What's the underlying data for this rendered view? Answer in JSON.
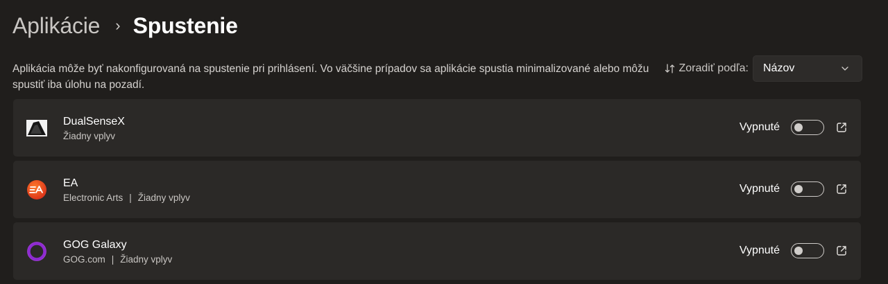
{
  "breadcrumb": {
    "parent": "Aplikácie",
    "separator": "›",
    "current": "Spustenie"
  },
  "description": "Aplikácia môže byť nakonfigurovaná na spustenie pri prihlásení. Vo väčšine prípadov sa aplikácie spustia minimalizované alebo môžu spustiť iba úlohu na pozadí.",
  "sort": {
    "label": "Zoradiť podľa:",
    "selected": "Názov",
    "icon": "sort-arrows-icon"
  },
  "apps": [
    {
      "name": "DualSenseX",
      "publisher": "",
      "impact": "Žiadny vplyv",
      "status": "Vypnuté",
      "enabled": false,
      "icon": "dualsensex-icon"
    },
    {
      "name": "EA",
      "publisher": "Electronic Arts",
      "impact": "Žiadny vplyv",
      "status": "Vypnuté",
      "enabled": false,
      "icon": "ea-icon",
      "icon_color": "#e8431c"
    },
    {
      "name": "GOG Galaxy",
      "publisher": "GOG.com",
      "impact": "Žiadny vplyv",
      "status": "Vypnuté",
      "enabled": false,
      "icon": "gog-galaxy-icon",
      "icon_color": "#9b2fd6"
    }
  ],
  "separator_char": "|",
  "colors": {
    "background": "#201e1c",
    "card": "#2b2927",
    "text_secondary": "#c9c6c3"
  }
}
